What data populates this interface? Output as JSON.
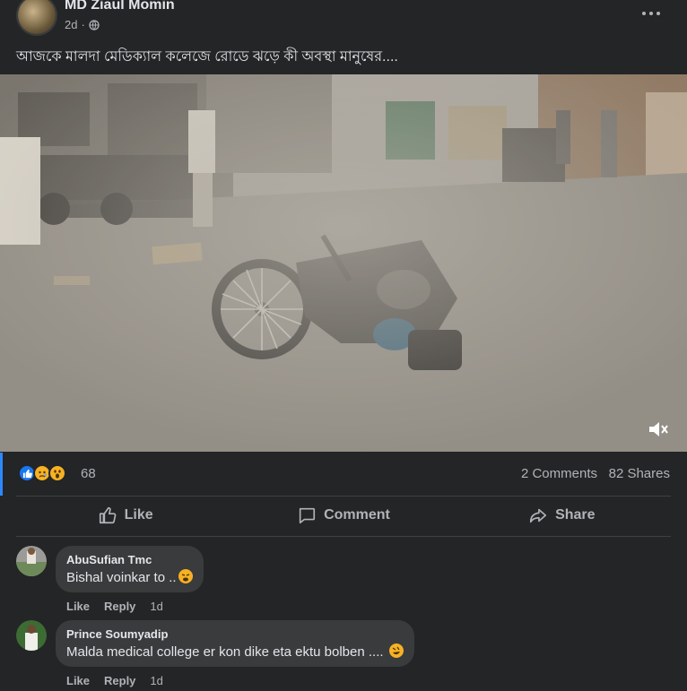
{
  "post": {
    "author": "MD Ziaul Momin",
    "time": "2d",
    "caption": "আজকে মালদা মেডিক্যাল কলেজে রোডে ঝড়ে কী অবস্থা মানুষের...."
  },
  "stats": {
    "reaction_count": "68",
    "comments": "2 Comments",
    "shares": "82 Shares",
    "reactions": [
      "like-icon",
      "sad-icon",
      "wow-icon"
    ]
  },
  "actions": {
    "like": "Like",
    "comment": "Comment",
    "share": "Share"
  },
  "comments": [
    {
      "name": "AbuSufian Tmc",
      "text": "Bishal voinkar to ..",
      "emoji": "weary-face-emoji",
      "like": "Like",
      "reply": "Reply",
      "time": "1d"
    },
    {
      "name": "Prince Soumyadip",
      "text": "Malda medical college er kon dike eta ektu bolben ....",
      "emoji": "rolling-laughing-emoji",
      "like": "Like",
      "reply": "Reply",
      "time": "1d"
    }
  ],
  "colors": {
    "background": "#242526",
    "accent": "#2d88ff",
    "bubble": "#3a3b3c",
    "secondary_text": "#b0b3b8"
  }
}
